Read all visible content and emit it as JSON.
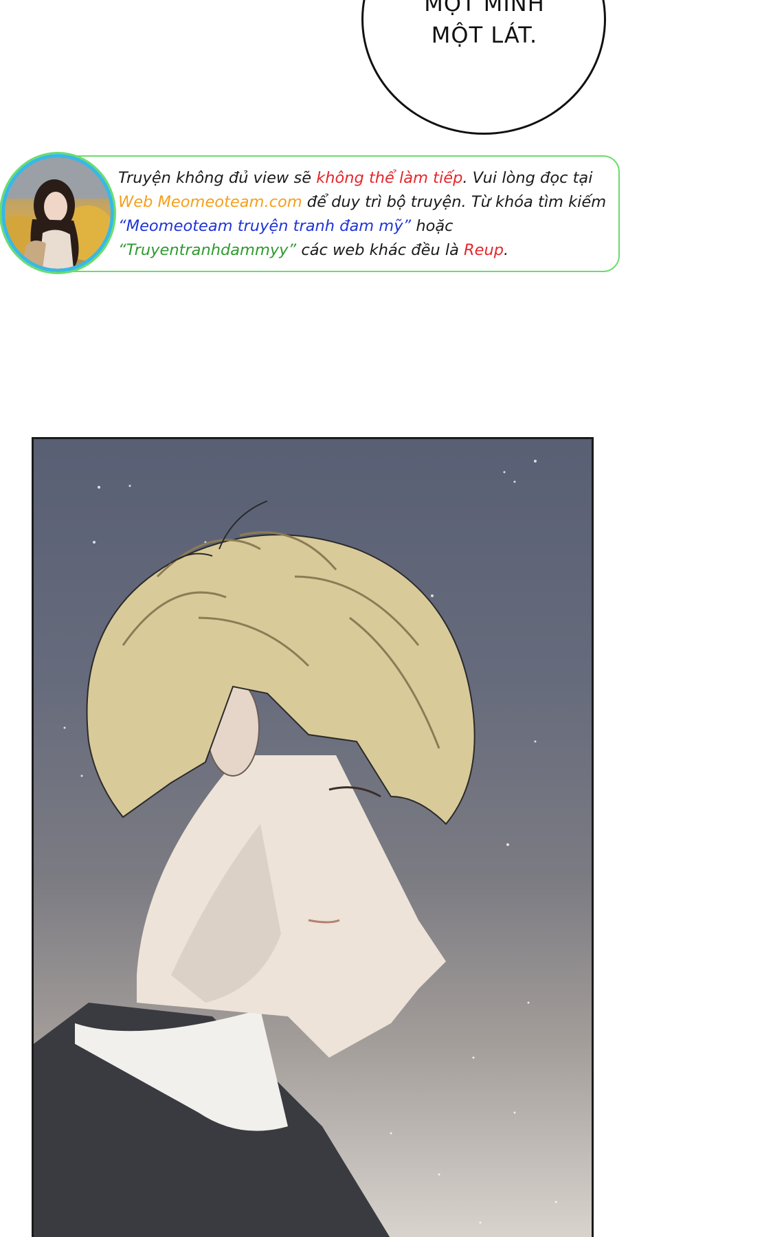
{
  "speech_bubble": {
    "lines": [
      "MỘT MÌNH",
      "MỘT LÁT."
    ]
  },
  "notice": {
    "line1": {
      "part1": "Truyện không đủ view sẽ ",
      "part2": "không thể làm tiếp",
      "part3": ". Vui lòng đọc tại"
    },
    "line2": {
      "part1": "Web Meomeoteam.com",
      "part2": " để duy trì bộ truyện. Từ khóa tìm kiếm"
    },
    "line3": {
      "part1": "“Meomeoteam truyện tranh đam mỹ”",
      "part2": " hoặc"
    },
    "line4": {
      "part1": "“Truyentranhdammyy”",
      "part2": " các web khác đều là ",
      "part3": "Reup",
      "part4": "."
    }
  },
  "colors": {
    "red": "#e5262a",
    "orange": "#f4a01b",
    "blue": "#1e35d6",
    "green": "#2f9a2f",
    "notice_border": "#6bdc6b",
    "avatar_ring": "#35b9e8"
  },
  "panel": {
    "illustration": "blond-man-profile-night-sky"
  }
}
